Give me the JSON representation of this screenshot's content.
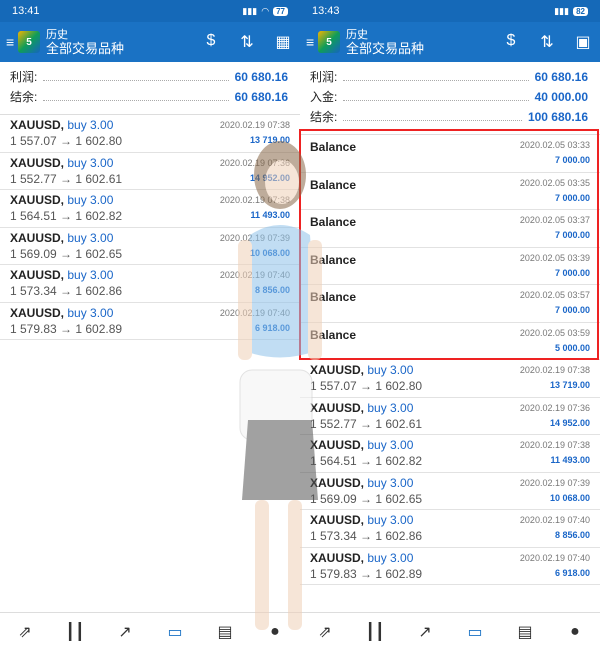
{
  "left": {
    "status": {
      "time": "13:41",
      "battery": "77"
    },
    "appbar": {
      "title_small": "历史",
      "title_large": "全部交易品种"
    },
    "summary": [
      {
        "label": "利润:",
        "value": "60 680.16"
      },
      {
        "label": "结余:",
        "value": "60 680.16"
      }
    ],
    "deals": [
      {
        "symbol": "XAUUSD,",
        "side": "buy 3.00",
        "prices": "1 557.07 → 1 602.80",
        "time": "2020.02.19 07:38",
        "profit": "13 719.00"
      },
      {
        "symbol": "XAUUSD,",
        "side": "buy 3.00",
        "prices": "1 552.77 → 1 602.61",
        "time": "2020.02.19 07:36",
        "profit": "14 952.00"
      },
      {
        "symbol": "XAUUSD,",
        "side": "buy 3.00",
        "prices": "1 564.51 → 1 602.82",
        "time": "2020.02.19 07:38",
        "profit": "11 493.00"
      },
      {
        "symbol": "XAUUSD,",
        "side": "buy 3.00",
        "prices": "1 569.09 → 1 602.65",
        "time": "2020.02.19 07:39",
        "profit": "10 068.00"
      },
      {
        "symbol": "XAUUSD,",
        "side": "buy 3.00",
        "prices": "1 573.34 → 1 602.86",
        "time": "2020.02.19 07:40",
        "profit": "8 856.00"
      },
      {
        "symbol": "XAUUSD,",
        "side": "buy 3.00",
        "prices": "1 579.83 → 1 602.89",
        "time": "2020.02.19 07:40",
        "profit": "6 918.00"
      }
    ]
  },
  "right": {
    "status": {
      "time": "13:43",
      "battery": "82"
    },
    "appbar": {
      "title_small": "历史",
      "title_large": "全部交易品种"
    },
    "summary": [
      {
        "label": "利润:",
        "value": "60 680.16"
      },
      {
        "label": "入金:",
        "value": "40 000.00"
      },
      {
        "label": "结余:",
        "value": "100 680.16"
      }
    ],
    "balances": [
      {
        "title": "Balance",
        "time": "2020.02.05 03:33",
        "amount": "7 000.00"
      },
      {
        "title": "Balance",
        "time": "2020.02.05 03:35",
        "amount": "7 000.00"
      },
      {
        "title": "Balance",
        "time": "2020.02.05 03:37",
        "amount": "7 000.00"
      },
      {
        "title": "Balance",
        "time": "2020.02.05 03:39",
        "amount": "7 000.00"
      },
      {
        "title": "Balance",
        "time": "2020.02.05 03:57",
        "amount": "7 000.00"
      },
      {
        "title": "Balance",
        "time": "2020.02.05 03:59",
        "amount": "5 000.00"
      }
    ],
    "deals": [
      {
        "symbol": "XAUUSD,",
        "side": "buy 3.00",
        "prices": "1 557.07 → 1 602.80",
        "time": "2020.02.19 07:38",
        "profit": "13 719.00"
      },
      {
        "symbol": "XAUUSD,",
        "side": "buy 3.00",
        "prices": "1 552.77 → 1 602.61",
        "time": "2020.02.19 07:36",
        "profit": "14 952.00"
      },
      {
        "symbol": "XAUUSD,",
        "side": "buy 3.00",
        "prices": "1 564.51 → 1 602.82",
        "time": "2020.02.19 07:38",
        "profit": "11 493.00"
      },
      {
        "symbol": "XAUUSD,",
        "side": "buy 3.00",
        "prices": "1 569.09 → 1 602.65",
        "time": "2020.02.19 07:39",
        "profit": "10 068.00"
      },
      {
        "symbol": "XAUUSD,",
        "side": "buy 3.00",
        "prices": "1 573.34 → 1 602.86",
        "time": "2020.02.19 07:40",
        "profit": "8 856.00"
      },
      {
        "symbol": "XAUUSD,",
        "side": "buy 3.00",
        "prices": "1 579.83 → 1 602.89",
        "time": "2020.02.19 07:40",
        "profit": "6 918.00"
      }
    ]
  },
  "icons": {
    "header": [
      "currency-icon",
      "sort-icon",
      "calendar-icon"
    ],
    "tabs": [
      "quotes-icon",
      "chart-icon",
      "trade-icon",
      "history-icon",
      "news-icon",
      "chat-icon"
    ]
  },
  "colors": {
    "appbar": "#1a72c4",
    "statusbar": "#1569b8",
    "value_blue": "#1a66c8",
    "highlight": "#ee2222"
  }
}
